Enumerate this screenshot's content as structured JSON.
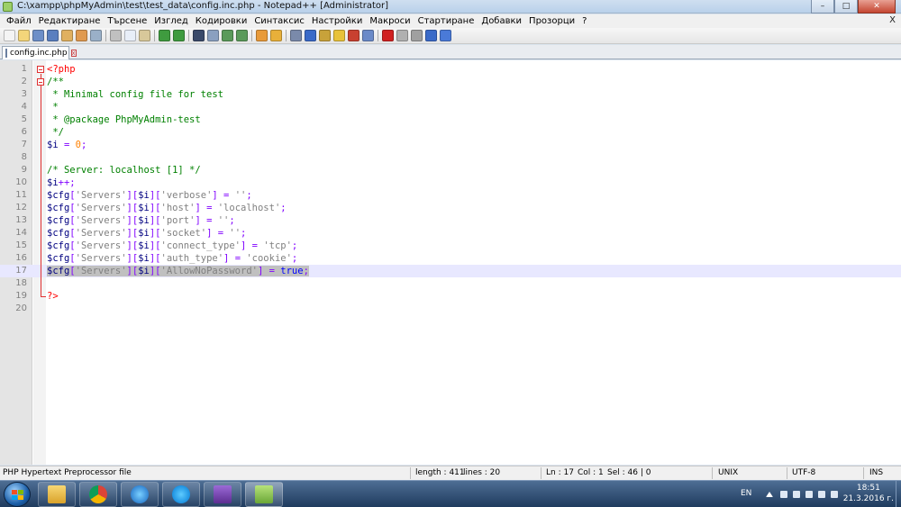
{
  "window": {
    "title": "C:\\xampp\\phpMyAdmin\\test\\test_data\\config.inc.php - Notepad++ [Administrator]",
    "minimize": "–",
    "maximize": "□",
    "close": "✕"
  },
  "menu": {
    "items": [
      "Файл",
      "Редактиране",
      "Търсене",
      "Изглед",
      "Кодировки",
      "Синтаксис",
      "Настройки",
      "Макроси",
      "Стартиране",
      "Добавки",
      "Прозорци",
      "?"
    ],
    "close_doc": "X"
  },
  "toolbar": {
    "buttons": [
      "new-file-icon",
      "open-file-icon",
      "save-icon",
      "save-all-icon",
      "close-icon",
      "close-all-icon",
      "print-icon",
      "cut-icon",
      "copy-icon",
      "paste-icon",
      "undo-icon",
      "redo-icon",
      "find-icon",
      "replace-icon",
      "zoom-in-icon",
      "zoom-out-icon",
      "sync-vertical-icon",
      "sync-horizontal-icon",
      "word-wrap-icon",
      "show-all-chars-icon",
      "indent-guide-icon",
      "doc-map-icon",
      "function-list-icon",
      "folder-workspace-icon",
      "record-macro-icon",
      "stop-macro-icon",
      "play-macro-icon",
      "play-multiple-icon",
      "save-macro-icon"
    ]
  },
  "tab": {
    "label": "config.inc.php",
    "close": "x"
  },
  "editor": {
    "line_numbers": [
      "1",
      "2",
      "3",
      "4",
      "5",
      "6",
      "7",
      "8",
      "9",
      "10",
      "11",
      "12",
      "13",
      "14",
      "15",
      "16",
      "17",
      "18",
      "19",
      "20"
    ],
    "lines": [
      [
        [
          "tag",
          "<?php"
        ]
      ],
      [
        [
          "cmt",
          "/**"
        ]
      ],
      [
        [
          "cmt",
          " * Minimal config file for test"
        ]
      ],
      [
        [
          "cmt",
          " *"
        ]
      ],
      [
        [
          "cmt",
          " * @package PhpMyAdmin-test"
        ]
      ],
      [
        [
          "cmt",
          " */"
        ]
      ],
      [
        [
          "var",
          "$i"
        ],
        [
          "op",
          " = "
        ],
        [
          "num",
          "0"
        ],
        [
          "op",
          ";"
        ]
      ],
      [],
      [
        [
          "cmt",
          "/* Server: localhost [1] */"
        ]
      ],
      [
        [
          "var",
          "$i"
        ],
        [
          "op",
          "++;"
        ]
      ],
      [
        [
          "var",
          "$cfg"
        ],
        [
          "op",
          "["
        ],
        [
          "str",
          "'Servers'"
        ],
        [
          "op",
          "]["
        ],
        [
          "var",
          "$i"
        ],
        [
          "op",
          "]["
        ],
        [
          "str",
          "'verbose'"
        ],
        [
          "op",
          "] = "
        ],
        [
          "str",
          "''"
        ],
        [
          "op",
          ";"
        ]
      ],
      [
        [
          "var",
          "$cfg"
        ],
        [
          "op",
          "["
        ],
        [
          "str",
          "'Servers'"
        ],
        [
          "op",
          "]["
        ],
        [
          "var",
          "$i"
        ],
        [
          "op",
          "]["
        ],
        [
          "str",
          "'host'"
        ],
        [
          "op",
          "] = "
        ],
        [
          "str",
          "'localhost'"
        ],
        [
          "op",
          ";"
        ]
      ],
      [
        [
          "var",
          "$cfg"
        ],
        [
          "op",
          "["
        ],
        [
          "str",
          "'Servers'"
        ],
        [
          "op",
          "]["
        ],
        [
          "var",
          "$i"
        ],
        [
          "op",
          "]["
        ],
        [
          "str",
          "'port'"
        ],
        [
          "op",
          "] = "
        ],
        [
          "str",
          "''"
        ],
        [
          "op",
          ";"
        ]
      ],
      [
        [
          "var",
          "$cfg"
        ],
        [
          "op",
          "["
        ],
        [
          "str",
          "'Servers'"
        ],
        [
          "op",
          "]["
        ],
        [
          "var",
          "$i"
        ],
        [
          "op",
          "]["
        ],
        [
          "str",
          "'socket'"
        ],
        [
          "op",
          "] = "
        ],
        [
          "str",
          "''"
        ],
        [
          "op",
          ";"
        ]
      ],
      [
        [
          "var",
          "$cfg"
        ],
        [
          "op",
          "["
        ],
        [
          "str",
          "'Servers'"
        ],
        [
          "op",
          "]["
        ],
        [
          "var",
          "$i"
        ],
        [
          "op",
          "]["
        ],
        [
          "str",
          "'connect_type'"
        ],
        [
          "op",
          "] = "
        ],
        [
          "str",
          "'tcp'"
        ],
        [
          "op",
          ";"
        ]
      ],
      [
        [
          "var",
          "$cfg"
        ],
        [
          "op",
          "["
        ],
        [
          "str",
          "'Servers'"
        ],
        [
          "op",
          "]["
        ],
        [
          "var",
          "$i"
        ],
        [
          "op",
          "]["
        ],
        [
          "str",
          "'auth_type'"
        ],
        [
          "op",
          "] = "
        ],
        [
          "str",
          "'cookie'"
        ],
        [
          "op",
          ";"
        ]
      ],
      [
        [
          "var",
          "$cfg"
        ],
        [
          "op",
          "["
        ],
        [
          "str",
          "'Servers'"
        ],
        [
          "op",
          "]["
        ],
        [
          "var",
          "$i"
        ],
        [
          "op",
          "]["
        ],
        [
          "str",
          "'AllowNoPassword'"
        ],
        [
          "op",
          "] = "
        ],
        [
          "kw",
          "true"
        ],
        [
          "op",
          ";"
        ]
      ],
      [],
      [
        [
          "tag",
          "?>"
        ]
      ],
      []
    ],
    "current_line": 17
  },
  "status": {
    "file_type": "PHP Hypertext Preprocessor file",
    "length": "length : 411",
    "lines": "lines : 20",
    "ln": "Ln : 17",
    "col": "Col : 1",
    "sel": "Sel : 46 | 0",
    "eol": "UNIX",
    "encoding": "UTF-8",
    "mode": "INS"
  },
  "taskbar": {
    "apps": [
      "explorer-icon",
      "chrome-icon",
      "internet-explorer-icon",
      "skype-icon",
      "visual-studio-icon",
      "notepadpp-icon"
    ],
    "active_app": "notepadpp-icon",
    "lang": "EN",
    "time": "18:51",
    "date": "21.3.2016 г."
  },
  "colors": {
    "tag": "#ff0000",
    "comment": "#008000",
    "variable": "#000080",
    "operator": "#8000ff",
    "string": "#808080",
    "number": "#ff8000",
    "keyword": "#0000ff",
    "current_line": "#e8e8ff"
  }
}
